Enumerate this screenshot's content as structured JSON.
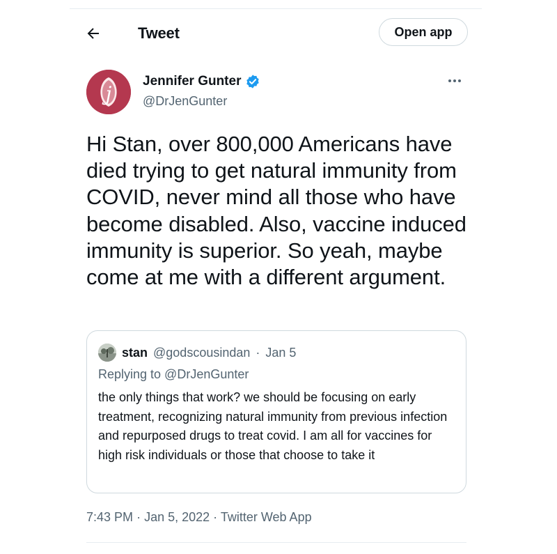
{
  "header": {
    "title": "Tweet",
    "open_app_label": "Open app",
    "back_icon": "arrow-left-icon"
  },
  "author": {
    "name": "Jennifer Gunter",
    "handle": "@DrJenGunter",
    "verified": true,
    "avatar_color": "#b4384f",
    "verified_color": "#1d9bf0"
  },
  "tweet": {
    "text": "Hi Stan, over 800,000 Americans have died trying to get natural immunity from COVID, never mind all those who have become disabled. Also, vaccine induced immunity is superior. So yeah, maybe come at me with a different argument."
  },
  "quote": {
    "name": "stan",
    "handle": "@godscousindan",
    "separator": "·",
    "date": "Jan 5",
    "replying_to": "Replying to @DrJenGunter",
    "text": "the only things that work? we should be focusing on early treatment, recognizing natural immunity from previous infection and repurposed drugs to treat covid. I am all for vaccines for high risk individuals or those that choose to take it"
  },
  "meta": {
    "time": "7:43 PM",
    "separator": "·",
    "date": "Jan 5, 2022",
    "client": "Twitter Web App"
  }
}
